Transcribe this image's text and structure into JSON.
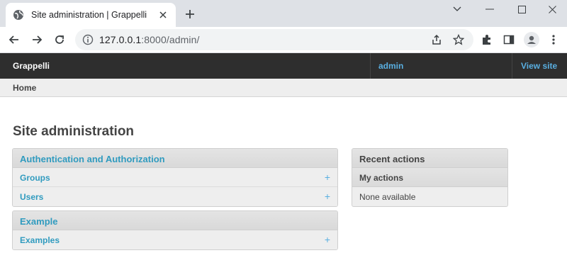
{
  "browser": {
    "tab_title": "Site administration | Grappelli",
    "url_host": "127.0.0.1",
    "url_rest": ":8000/admin/",
    "icons": [
      "globe-icon",
      "close-icon",
      "plus-icon",
      "minimize-icon",
      "maximize-icon",
      "close-window-icon",
      "back-arrow-icon",
      "forward-arrow-icon",
      "reload-icon",
      "info-icon",
      "share-icon",
      "star-icon",
      "extensions-icon",
      "side-panel-icon",
      "profile-icon",
      "kebab-menu-icon"
    ]
  },
  "header": {
    "brand": "Grappelli",
    "user": "admin",
    "view_site": "View site"
  },
  "breadcrumb": {
    "home": "Home"
  },
  "page": {
    "title": "Site administration"
  },
  "apps": [
    {
      "name": "Authentication and Authorization",
      "models": [
        {
          "label": "Groups",
          "add": "+"
        },
        {
          "label": "Users",
          "add": "+"
        }
      ]
    },
    {
      "name": "Example",
      "models": [
        {
          "label": "Examples",
          "add": "+"
        }
      ]
    }
  ],
  "recent": {
    "title": "Recent actions",
    "subtitle": "My actions",
    "empty": "None available"
  },
  "colors": {
    "link": "#309bbf",
    "header_bg": "#2e2e2e",
    "header_link": "#59afe1"
  }
}
